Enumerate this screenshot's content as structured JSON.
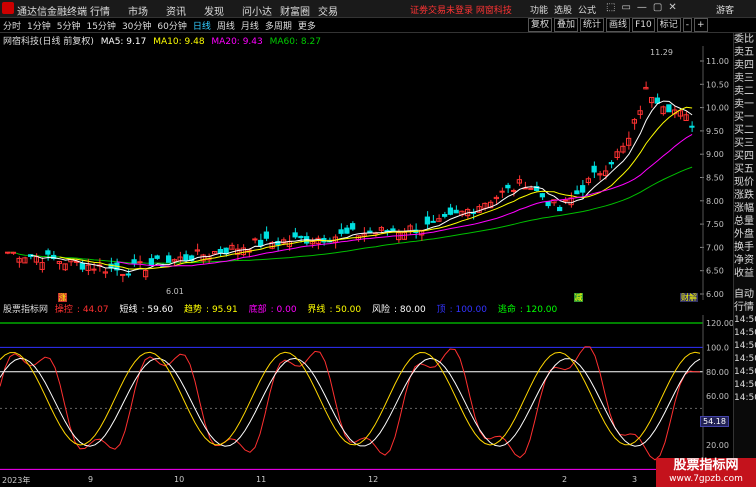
{
  "app": {
    "name": "通达信金融终端",
    "menu": [
      "行情",
      "市场",
      "资讯",
      "发现",
      "问小达",
      "财富圈",
      "交易"
    ],
    "notice": "证劵交易未登录 网窗科技",
    "right_menu": [
      "功能",
      "选股",
      "公式"
    ],
    "window_buttons": [
      "⬚",
      "▭",
      "—",
      "▢",
      "✕"
    ],
    "guest": "游客"
  },
  "toolbar": {
    "periods": [
      "分时",
      "1分钟",
      "5分钟",
      "15分钟",
      "30分钟",
      "60分钟",
      "日线",
      "周线",
      "月线",
      "多周期",
      "更多"
    ],
    "active_period": "日线",
    "tools": [
      "复权",
      "叠加",
      "统计",
      "画线",
      "F10",
      "标记",
      "-",
      "+"
    ]
  },
  "main_legend": {
    "stock": "网宿科技(日线 前复权)",
    "ma5": "MA5: 9.17",
    "ma10": "MA10: 9.48",
    "ma20": "MA20: 9.43",
    "ma60": "MA60: 8.27",
    "colors": {
      "ma5": "#ffffff",
      "ma10": "#ffff00",
      "ma20": "#ff00ff",
      "ma60": "#00c000"
    }
  },
  "price_axis": {
    "labels": [
      "11.00",
      "10.50",
      "10.00",
      "9.50",
      "9.00",
      "8.50",
      "8.00",
      "7.50",
      "7.00",
      "6.50",
      "6.00"
    ],
    "high_label": "11.29",
    "low_label": "6.01"
  },
  "right_panel": {
    "items": [
      "委比",
      "卖五",
      "卖四",
      "卖三",
      "卖二",
      "卖一",
      "买一",
      "买二",
      "买三",
      "买四",
      "买五",
      "现价",
      "涨跌",
      "涨幅",
      "总量",
      "外盘",
      "换手",
      "净资",
      "收益"
    ],
    "items2": [
      "自动",
      "行情"
    ],
    "times": [
      "14:50",
      "14:50",
      "14:50",
      "14:50",
      "14:50",
      "14:50",
      "14:50",
      "14:50",
      "14:50"
    ]
  },
  "sub_indicator": {
    "title": "股票指标网",
    "fields": [
      {
        "label": "操控",
        "value": "44.07",
        "color": "#ff3030"
      },
      {
        "label": "短线",
        "value": "59.60",
        "color": "#ffffff"
      },
      {
        "label": "趋势",
        "value": "95.91",
        "color": "#ffff00"
      },
      {
        "label": "底部",
        "value": "0.00",
        "color": "#ff00ff"
      },
      {
        "label": "界线",
        "value": "50.00",
        "color": "#ffff00"
      },
      {
        "label": "风险",
        "value": "80.00",
        "color": "#ffffff"
      },
      {
        "label": "顶",
        "value": "100.00",
        "color": "#3030ff"
      },
      {
        "label": "逃命",
        "value": "120.00",
        "color": "#00ff00"
      }
    ],
    "axis_labels": [
      "120.00",
      "100.0",
      "80.00",
      "60.00",
      "40.00",
      "20.00"
    ],
    "current_value": "54.18"
  },
  "markers": {
    "buy1": "涨",
    "buy2": "减",
    "sell": "财解"
  },
  "date_axis": [
    "2023年",
    "9",
    "10",
    "11",
    "12",
    "2",
    "3"
  ],
  "watermark": {
    "line1": "股票指标网",
    "line2": "www.7gpzb.com"
  }
}
